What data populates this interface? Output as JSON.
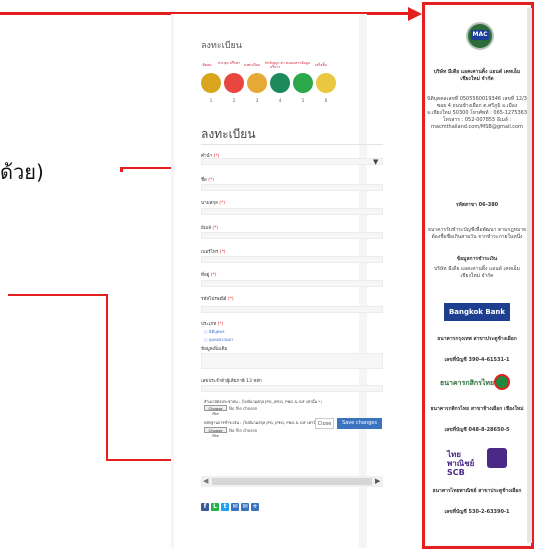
{
  "left_fragment": "ด้วย)",
  "page_heading": "ลงทะเบียน",
  "steps": [
    {
      "label": "ติดต่อ",
      "num": "1",
      "color": "#d8a51c"
    },
    {
      "label": "ประชุม ปรึกษา",
      "num": "2",
      "color": "#e8463e"
    },
    {
      "label": "ลงทะเบียน",
      "num": "3",
      "color": "#e6a935"
    },
    {
      "label": "ทำสัญญา ค่าบริการ",
      "num": "4",
      "color": "#1d8a5c"
    },
    {
      "label": "ส่งเอกสารข้อมูล",
      "num": "5",
      "color": "#2aa84a"
    },
    {
      "label": "เสร็จสิ้น",
      "num": "6",
      "color": "#e8c840"
    }
  ],
  "form": {
    "title": "ลงทะเบียน",
    "fields": [
      {
        "label": "คำนำ",
        "req": "(*)"
      },
      {
        "label": "ชื่อ",
        "req": "(*)"
      },
      {
        "label": "นามสกุล",
        "req": "(*)"
      },
      {
        "label": "อีเมล์",
        "req": "(*)"
      },
      {
        "label": "เบอร์โทร",
        "req": "(*)"
      },
      {
        "label": "ที่อยู่",
        "req": "(*)"
      },
      {
        "label": "รหัสไปรษณีย์",
        "req": "(*)"
      }
    ],
    "type_label": "ประเภท",
    "type_req": "(*)",
    "radio_1": "นิติบุคคล",
    "radio_2": "บุคคลธรรมดา",
    "note_label": "ข้อมูลเพิ่มเติม",
    "taxid_label": "เลขประจำตัวผู้เสียภาษี 13 หลัก",
    "file1_label": "สำเนาบัตรประชาชน : (ไฟล์นามสกุล JPG, JPEG, PNG & GIF เท่านั้น",
    "file2_label": "หลักฐานการชำระเงิน : (ไฟล์นามสกุล JPG, JPEG, PNG & GIF เท่านั้น",
    "file_req": "*)",
    "choose_file": "Choose File",
    "no_file": "No file chosen",
    "close": "Close",
    "save": "Save changes"
  },
  "scroll_left": "◀",
  "scroll_right": "▶",
  "social": [
    {
      "glyph": "f",
      "color": "#3b5998"
    },
    {
      "glyph": "L",
      "color": "#1fb34a"
    },
    {
      "glyph": "t",
      "color": "#1da1f2"
    },
    {
      "glyph": "✉",
      "color": "#3a74c0"
    },
    {
      "glyph": "✉",
      "color": "#3a74c0"
    },
    {
      "glyph": "+",
      "color": "#3a74c0"
    }
  ],
  "info": {
    "logo_text": "MAC",
    "company": "บริษัท มีเดีย แอคเคานติ้ง แอนด์ เคทเอ็ม เชียงใหม่ จำกัด",
    "address": "นิติบุคคลเลขที่ 0505560019346 เลขที่ 12/3 ซอย 4 ถนนช้างเผือก ต.ศรีภูมิ อ.เมือง จ.เชียงใหม่ 50300 โทรศัพท์ : 065-1275363 โทรสาร : 052-007855 อีเมล์ : macmthailand.com/MSB@gmail.com",
    "hours": "รหัสสาขา 06-380",
    "account_note": "ธนาคารรับชำระบัญชีเพื่อพัฒนา ตามกฎหมายต้องชื่อชื่อเกินสามวัน จากชำระภายในหนึ่ง",
    "account_name_title": "ข้อมูลการชำระเงิน",
    "account_name": "บริษัท มีเดีย แอคเคานติ้ง แอนด์ เคทเอ็ม เชียงใหม่ จำกัด",
    "bank1_logo": "Bangkok Bank",
    "bank1_branch": "ธนาคารกรุงเทพ สาขาประตูช้างเผือก",
    "bank1_acct": "เลขที่บัญชี 390-4-61531-1",
    "bank2_logo": "ธนาคารกสิกรไทย",
    "bank2_branch": "ธนาคารกสิกรไทย สาขาช้างเผือก เชียงใหม่",
    "bank2_acct": "เลขที่บัญชี 048-8-28650-5",
    "bank3_logo": "ไทยพาณิชย์ SCB",
    "bank3_branch": "ธนาคารไทยพาณิชย์ สาขาประตูช้างเผือก",
    "bank3_acct": "เลขที่บัญชี 530-2-63390-1"
  }
}
